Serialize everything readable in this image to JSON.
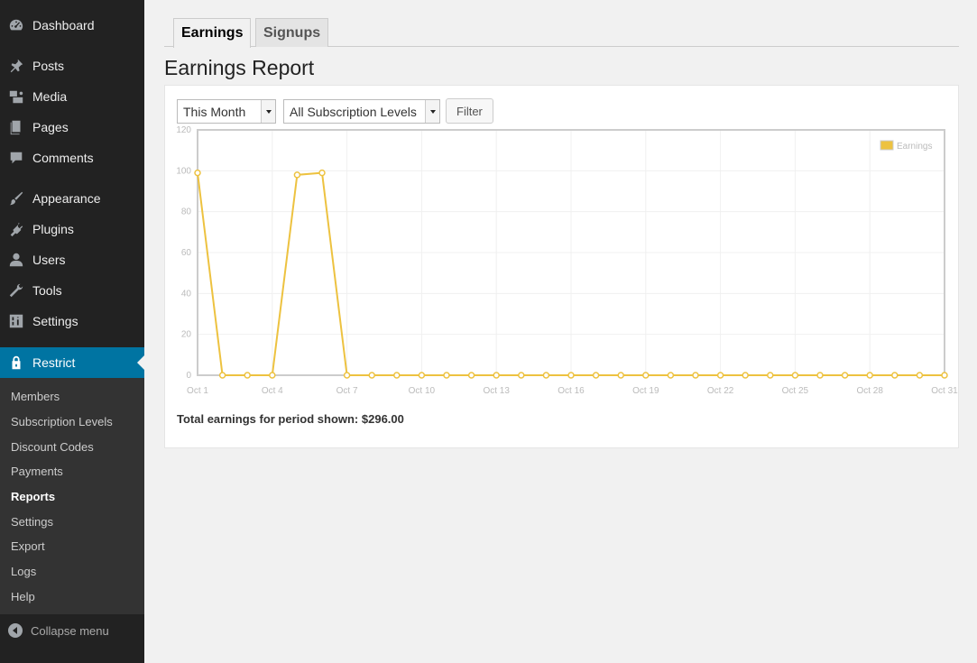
{
  "sidebar": {
    "items": [
      {
        "label": "Dashboard",
        "icon": "dashboard-icon"
      },
      {
        "label": "Posts",
        "icon": "pin-icon"
      },
      {
        "label": "Media",
        "icon": "media-icon"
      },
      {
        "label": "Pages",
        "icon": "pages-icon"
      },
      {
        "label": "Comments",
        "icon": "comment-icon"
      },
      {
        "label": "Appearance",
        "icon": "brush-icon"
      },
      {
        "label": "Plugins",
        "icon": "plugin-icon"
      },
      {
        "label": "Users",
        "icon": "user-icon"
      },
      {
        "label": "Tools",
        "icon": "wrench-icon"
      },
      {
        "label": "Settings",
        "icon": "settings-sliders-icon"
      },
      {
        "label": "Restrict",
        "icon": "lock-icon"
      }
    ],
    "submenu": [
      "Members",
      "Subscription Levels",
      "Discount Codes",
      "Payments",
      "Reports",
      "Settings",
      "Export",
      "Logs",
      "Help"
    ],
    "submenu_active": "Reports",
    "collapse_label": "Collapse menu"
  },
  "tabs": [
    "Earnings",
    "Signups"
  ],
  "page_title": "Earnings Report",
  "filters": {
    "period": "This Month",
    "level": "All Subscription Levels",
    "button": "Filter"
  },
  "colors": {
    "series": "#edc240",
    "accent": "#0074a2"
  },
  "chart_data": {
    "type": "line",
    "x": [
      "Oct 1",
      "Oct 2",
      "Oct 3",
      "Oct 4",
      "Oct 5",
      "Oct 6",
      "Oct 7",
      "Oct 8",
      "Oct 9",
      "Oct 10",
      "Oct 11",
      "Oct 12",
      "Oct 13",
      "Oct 14",
      "Oct 15",
      "Oct 16",
      "Oct 17",
      "Oct 18",
      "Oct 19",
      "Oct 20",
      "Oct 21",
      "Oct 22",
      "Oct 23",
      "Oct 24",
      "Oct 25",
      "Oct 26",
      "Oct 27",
      "Oct 28",
      "Oct 29",
      "Oct 30",
      "Oct 31"
    ],
    "x_tick_labels": [
      "Oct 1",
      "Oct 4",
      "Oct 7",
      "Oct 10",
      "Oct 13",
      "Oct 16",
      "Oct 19",
      "Oct 22",
      "Oct 25",
      "Oct 28",
      "Oct 31"
    ],
    "series": [
      {
        "name": "Earnings",
        "values": [
          99,
          0,
          0,
          0,
          98,
          99,
          0,
          0,
          0,
          0,
          0,
          0,
          0,
          0,
          0,
          0,
          0,
          0,
          0,
          0,
          0,
          0,
          0,
          0,
          0,
          0,
          0,
          0,
          0,
          0,
          0
        ]
      }
    ],
    "ylim": [
      0,
      120
    ],
    "y_ticks": [
      0,
      20,
      40,
      60,
      80,
      100,
      120
    ],
    "grid": true,
    "legend": "top-right"
  },
  "total": "Total earnings for period shown: $296.00"
}
